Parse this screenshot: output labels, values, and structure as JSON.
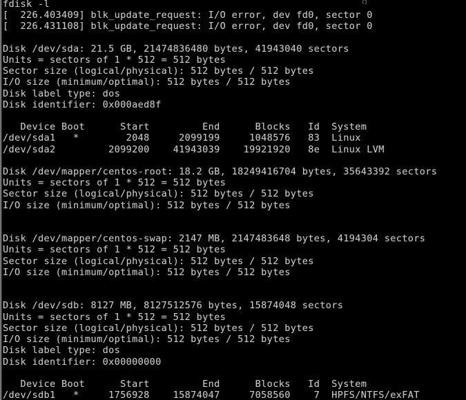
{
  "terminal": {
    "title": "fdisk -l",
    "background_color": "#000000",
    "foreground_color": "#c8c8c8",
    "font_size_px": 13.6,
    "line_height_px": 16.2,
    "columns": 84,
    "rows": 36,
    "scroll_artifact": "g",
    "command_line": "fdisk -l",
    "kernel_messages": [
      "[  226.403409] blk_update_request: I/O error, dev fd0, sector 0",
      "[  226.431108] blk_update_request: I/O error, dev fd0, sector 0"
    ],
    "disks": [
      {
        "name": "/dev/sda",
        "header": "Disk /dev/sda: 21.5 GB, 21474836480 bytes, 41943040 sectors",
        "size_human": "21.5 GB",
        "size_bytes": "21474836480",
        "sectors": "41943040",
        "units": "Units = sectors of 1 * 512 = 512 bytes",
        "sector_size": "Sector size (logical/physical): 512 bytes / 512 bytes",
        "io_size": "I/O size (minimum/optimal): 512 bytes / 512 bytes",
        "label_type": "Disk label type: dos",
        "identifier": "Disk identifier: 0x000aed8f",
        "table_header": "   Device Boot      Start         End      Blocks   Id  System",
        "partitions": [
          "/dev/sda1   *        2048     2099199     1048576   83  Linux",
          "/dev/sda2         2099200    41943039    19921920   8e  Linux LVM"
        ]
      },
      {
        "name": "/dev/mapper/centos-root",
        "header": "Disk /dev/mapper/centos-root: 18.2 GB, 18249416704 bytes, 35643392 sectors",
        "size_human": "18.2 GB",
        "size_bytes": "18249416704",
        "sectors": "35643392",
        "units": "Units = sectors of 1 * 512 = 512 bytes",
        "sector_size": "Sector size (logical/physical): 512 bytes / 512 bytes",
        "io_size": "I/O size (minimum/optimal): 512 bytes / 512 bytes",
        "label_type": "",
        "identifier": "",
        "table_header": "",
        "partitions": []
      },
      {
        "name": "/dev/mapper/centos-swap",
        "header": "Disk /dev/mapper/centos-swap: 2147 MB, 2147483648 bytes, 4194304 sectors",
        "size_human": "2147 MB",
        "size_bytes": "2147483648",
        "sectors": "4194304",
        "units": "Units = sectors of 1 * 512 = 512 bytes",
        "sector_size": "Sector size (logical/physical): 512 bytes / 512 bytes",
        "io_size": "I/O size (minimum/optimal): 512 bytes / 512 bytes",
        "label_type": "",
        "identifier": "",
        "table_header": "",
        "partitions": []
      },
      {
        "name": "/dev/sdb",
        "header": "Disk /dev/sdb: 8127 MB, 8127512576 bytes, 15874048 sectors",
        "size_human": "8127 MB",
        "size_bytes": "8127512576",
        "sectors": "15874048",
        "units": "Units = sectors of 1 * 512 = 512 bytes",
        "sector_size": "Sector size (logical/physical): 512 bytes / 512 bytes",
        "io_size": "I/O size (minimum/optimal): 512 bytes / 512 bytes",
        "label_type": "Disk label type: dos",
        "identifier": "Disk identifier: 0x00000000",
        "table_header": "   Device Boot      Start         End      Blocks   Id  System",
        "partitions": [
          "/dev/sdb1   *     1756928    15874047     7058560    7  HPFS/NTFS/exFAT"
        ]
      }
    ],
    "screen_text": "fdisk -l\n[  226.403409] blk_update_request: I/O error, dev fd0, sector 0\n[  226.431108] blk_update_request: I/O error, dev fd0, sector 0\n\nDisk /dev/sda: 21.5 GB, 21474836480 bytes, 41943040 sectors\nUnits = sectors of 1 * 512 = 512 bytes\nSector size (logical/physical): 512 bytes / 512 bytes\nI/O size (minimum/optimal): 512 bytes / 512 bytes\nDisk label type: dos\nDisk identifier: 0x000aed8f\n\n   Device Boot      Start         End      Blocks   Id  System\n/dev/sda1   *        2048     2099199     1048576   83  Linux\n/dev/sda2         2099200    41943039    19921920   8e  Linux LVM\n\nDisk /dev/mapper/centos-root: 18.2 GB, 18249416704 bytes, 35643392 sectors\nUnits = sectors of 1 * 512 = 512 bytes\nSector size (logical/physical): 512 bytes / 512 bytes\nI/O size (minimum/optimal): 512 bytes / 512 bytes\n\n\nDisk /dev/mapper/centos-swap: 2147 MB, 2147483648 bytes, 4194304 sectors\nUnits = sectors of 1 * 512 = 512 bytes\nSector size (logical/physical): 512 bytes / 512 bytes\nI/O size (minimum/optimal): 512 bytes / 512 bytes\n\n\nDisk /dev/sdb: 8127 MB, 8127512576 bytes, 15874048 sectors\nUnits = sectors of 1 * 512 = 512 bytes\nSector size (logical/physical): 512 bytes / 512 bytes\nI/O size (minimum/optimal): 512 bytes / 512 bytes\nDisk label type: dos\nDisk identifier: 0x00000000\n\n   Device Boot      Start         End      Blocks   Id  System\n/dev/sdb1   *     1756928    15874047     7058560    7  HPFS/NTFS/exFAT"
  }
}
